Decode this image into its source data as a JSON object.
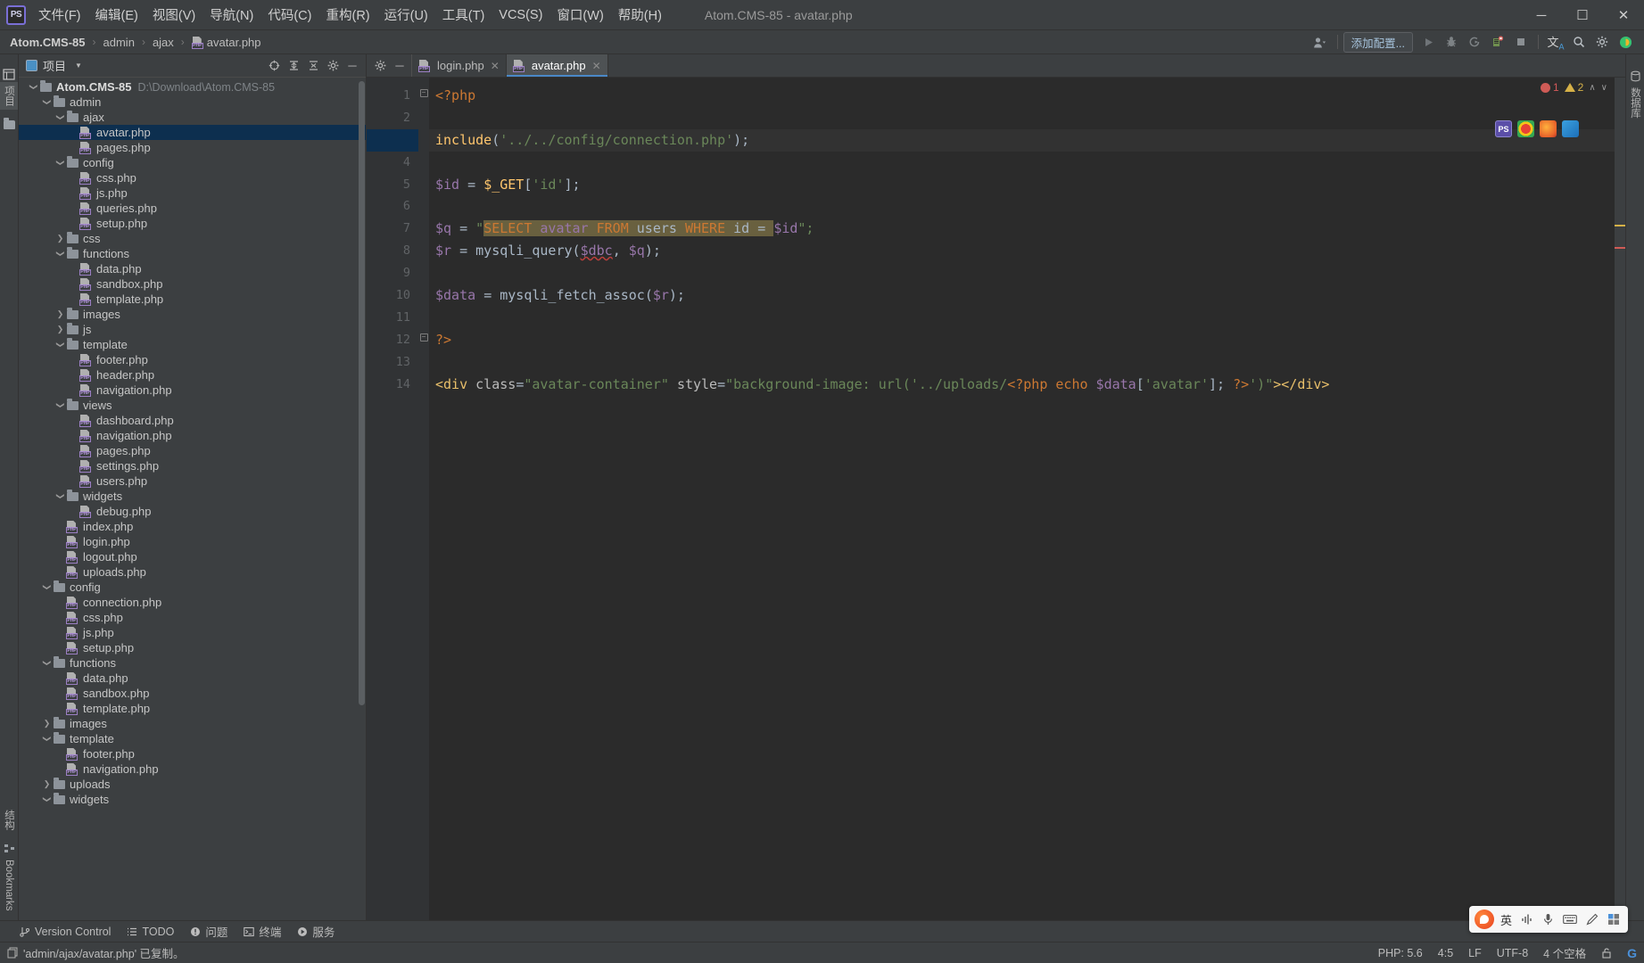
{
  "window": {
    "title": "Atom.CMS-85 - avatar.php",
    "logo_text": "PS",
    "minimize": "─",
    "maximize": "☐",
    "close": "✕"
  },
  "menubar": {
    "items": [
      {
        "label": "文件(F)",
        "name": "menu-file"
      },
      {
        "label": "编辑(E)",
        "name": "menu-edit"
      },
      {
        "label": "视图(V)",
        "name": "menu-view"
      },
      {
        "label": "导航(N)",
        "name": "menu-navigate"
      },
      {
        "label": "代码(C)",
        "name": "menu-code"
      },
      {
        "label": "重构(R)",
        "name": "menu-refactor"
      },
      {
        "label": "运行(U)",
        "name": "menu-run"
      },
      {
        "label": "工具(T)",
        "name": "menu-tools"
      },
      {
        "label": "VCS(S)",
        "name": "menu-vcs"
      },
      {
        "label": "窗口(W)",
        "name": "menu-window"
      },
      {
        "label": "帮助(H)",
        "name": "menu-help"
      }
    ]
  },
  "breadcrumb": {
    "items": [
      "Atom.CMS-85",
      "admin",
      "ajax",
      "avatar.php"
    ],
    "separator": "›"
  },
  "navtoolbar": {
    "add_config_label": "添加配置...",
    "icons": [
      {
        "name": "user-account-icon",
        "glyph": "👤"
      },
      {
        "name": "run-icon",
        "glyph": "▶"
      },
      {
        "name": "debug-icon",
        "glyph": "🐞"
      },
      {
        "name": "run-with-coverage-icon",
        "glyph": "⟳"
      },
      {
        "name": "profile-icon",
        "glyph": "⚙"
      },
      {
        "name": "stop-icon",
        "glyph": "■"
      },
      {
        "name": "translate-icon",
        "glyph": "文"
      },
      {
        "name": "search-everywhere-icon",
        "glyph": "⚲"
      },
      {
        "name": "settings-gear-icon",
        "glyph": "⚙"
      },
      {
        "name": "browser-icon",
        "glyph": "◖"
      }
    ]
  },
  "left_strip": {
    "project_tab": "项目",
    "structure_tab": "结构",
    "bookmarks_tab": "Bookmarks"
  },
  "right_strip": {
    "database_tab": "数据库"
  },
  "project_panel": {
    "title": "项目",
    "header_icons": [
      {
        "name": "scroll-from-source-icon",
        "glyph": "⊕"
      },
      {
        "name": "expand-all-icon",
        "glyph": "⇥"
      },
      {
        "name": "collapse-all-icon",
        "glyph": "↥"
      },
      {
        "name": "settings-gear-icon",
        "glyph": "⚙"
      },
      {
        "name": "hide-icon",
        "glyph": "─"
      }
    ],
    "tree": [
      {
        "label": "Atom.CMS-85",
        "path": "D:\\Download\\Atom.CMS-85",
        "depth": 0,
        "type": "folder",
        "state": "expanded",
        "bold": true
      },
      {
        "label": "admin",
        "depth": 1,
        "type": "folder",
        "state": "expanded"
      },
      {
        "label": "ajax",
        "depth": 2,
        "type": "folder",
        "state": "expanded"
      },
      {
        "label": "avatar.php",
        "depth": 3,
        "type": "php",
        "selected": true
      },
      {
        "label": "pages.php",
        "depth": 3,
        "type": "php"
      },
      {
        "label": "config",
        "depth": 2,
        "type": "folder",
        "state": "expanded"
      },
      {
        "label": "css.php",
        "depth": 3,
        "type": "php"
      },
      {
        "label": "js.php",
        "depth": 3,
        "type": "php"
      },
      {
        "label": "queries.php",
        "depth": 3,
        "type": "php"
      },
      {
        "label": "setup.php",
        "depth": 3,
        "type": "php"
      },
      {
        "label": "css",
        "depth": 2,
        "type": "folder",
        "state": "collapsed"
      },
      {
        "label": "functions",
        "depth": 2,
        "type": "folder",
        "state": "expanded"
      },
      {
        "label": "data.php",
        "depth": 3,
        "type": "php"
      },
      {
        "label": "sandbox.php",
        "depth": 3,
        "type": "php"
      },
      {
        "label": "template.php",
        "depth": 3,
        "type": "php"
      },
      {
        "label": "images",
        "depth": 2,
        "type": "folder",
        "state": "collapsed"
      },
      {
        "label": "js",
        "depth": 2,
        "type": "folder",
        "state": "collapsed"
      },
      {
        "label": "template",
        "depth": 2,
        "type": "folder",
        "state": "expanded"
      },
      {
        "label": "footer.php",
        "depth": 3,
        "type": "php"
      },
      {
        "label": "header.php",
        "depth": 3,
        "type": "php"
      },
      {
        "label": "navigation.php",
        "depth": 3,
        "type": "php"
      },
      {
        "label": "views",
        "depth": 2,
        "type": "folder",
        "state": "expanded"
      },
      {
        "label": "dashboard.php",
        "depth": 3,
        "type": "php"
      },
      {
        "label": "navigation.php",
        "depth": 3,
        "type": "php"
      },
      {
        "label": "pages.php",
        "depth": 3,
        "type": "php"
      },
      {
        "label": "settings.php",
        "depth": 3,
        "type": "php"
      },
      {
        "label": "users.php",
        "depth": 3,
        "type": "php"
      },
      {
        "label": "widgets",
        "depth": 2,
        "type": "folder",
        "state": "expanded"
      },
      {
        "label": "debug.php",
        "depth": 3,
        "type": "php"
      },
      {
        "label": "index.php",
        "depth": 2,
        "type": "php"
      },
      {
        "label": "login.php",
        "depth": 2,
        "type": "php"
      },
      {
        "label": "logout.php",
        "depth": 2,
        "type": "php"
      },
      {
        "label": "uploads.php",
        "depth": 2,
        "type": "php"
      },
      {
        "label": "config",
        "depth": 1,
        "type": "folder",
        "state": "expanded"
      },
      {
        "label": "connection.php",
        "depth": 2,
        "type": "php"
      },
      {
        "label": "css.php",
        "depth": 2,
        "type": "php"
      },
      {
        "label": "js.php",
        "depth": 2,
        "type": "php"
      },
      {
        "label": "setup.php",
        "depth": 2,
        "type": "php"
      },
      {
        "label": "functions",
        "depth": 1,
        "type": "folder",
        "state": "expanded"
      },
      {
        "label": "data.php",
        "depth": 2,
        "type": "php"
      },
      {
        "label": "sandbox.php",
        "depth": 2,
        "type": "php"
      },
      {
        "label": "template.php",
        "depth": 2,
        "type": "php"
      },
      {
        "label": "images",
        "depth": 1,
        "type": "folder",
        "state": "collapsed"
      },
      {
        "label": "template",
        "depth": 1,
        "type": "folder",
        "state": "expanded"
      },
      {
        "label": "footer.php",
        "depth": 2,
        "type": "php"
      },
      {
        "label": "navigation.php",
        "depth": 2,
        "type": "php"
      },
      {
        "label": "uploads",
        "depth": 1,
        "type": "folder",
        "state": "collapsed"
      },
      {
        "label": "widgets",
        "depth": 1,
        "type": "folder",
        "state": "expanded"
      }
    ]
  },
  "editor": {
    "tabs": [
      {
        "label": "login.php",
        "active": false,
        "name": "editor-tab-login"
      },
      {
        "label": "avatar.php",
        "active": true,
        "name": "editor-tab-avatar"
      }
    ],
    "tab_close_glyph": "✕",
    "inspection": {
      "errors": "1",
      "warnings": "2",
      "up_arrow": "∧",
      "down_arrow": "∨"
    },
    "float_buttons": [
      {
        "name": "phpstorm-badge",
        "label": "PS",
        "color": "#6f5fc0"
      },
      {
        "name": "chrome-badge",
        "label": "",
        "color": "#f0b429"
      },
      {
        "name": "firefox-badge",
        "label": "",
        "color": "#e8622a"
      },
      {
        "name": "edge-badge",
        "label": "",
        "color": "#3aa0e0"
      }
    ],
    "line_numbers": [
      "1",
      "2",
      "3",
      "4",
      "5",
      "6",
      "7",
      "8",
      "9",
      "10",
      "11",
      "12",
      "13",
      "14"
    ],
    "current_line": 3,
    "code_lines": [
      {
        "n": 1,
        "tokens": [
          {
            "t": "<?php",
            "c": "kw"
          }
        ]
      },
      {
        "n": 2,
        "tokens": []
      },
      {
        "n": 3,
        "tokens": [
          {
            "t": "include",
            "c": "fn"
          },
          {
            "t": "(",
            "c": "pl"
          },
          {
            "t": "'../../config/connection.php'",
            "c": "str"
          },
          {
            "t": ");",
            "c": "pl"
          }
        ]
      },
      {
        "n": 4,
        "tokens": []
      },
      {
        "n": 5,
        "tokens": [
          {
            "t": "$id ",
            "c": "var"
          },
          {
            "t": "= ",
            "c": "pl"
          },
          {
            "t": "$_GET",
            "c": "fn"
          },
          {
            "t": "[",
            "c": "pl"
          },
          {
            "t": "'id'",
            "c": "str"
          },
          {
            "t": "];",
            "c": "pl"
          }
        ]
      },
      {
        "n": 6,
        "tokens": []
      },
      {
        "n": 7,
        "tokens": [
          {
            "t": "$q ",
            "c": "var"
          },
          {
            "t": "= ",
            "c": "pl"
          },
          {
            "t": "\"",
            "c": "str"
          },
          {
            "t": "SELECT ",
            "c": "sql-kw sqlbg"
          },
          {
            "t": "avatar ",
            "c": "sql-id sqlbg"
          },
          {
            "t": "FROM ",
            "c": "sql-kw sqlbg"
          },
          {
            "t": "users ",
            "c": "sql-pl sqlbg"
          },
          {
            "t": "WHERE ",
            "c": "sql-kw sqlbg"
          },
          {
            "t": "id ",
            "c": "sql-pl sqlbg"
          },
          {
            "t": "= ",
            "c": "sql-pl sqlbg"
          },
          {
            "t": "$id",
            "c": "var"
          },
          {
            "t": "\";",
            "c": "str"
          }
        ]
      },
      {
        "n": 8,
        "tokens": [
          {
            "t": "$r ",
            "c": "var"
          },
          {
            "t": "= ",
            "c": "pl"
          },
          {
            "t": "mysqli_query",
            "c": "pl"
          },
          {
            "t": "(",
            "c": "pl"
          },
          {
            "t": "$dbc",
            "c": "var wavy"
          },
          {
            "t": ", ",
            "c": "pl"
          },
          {
            "t": "$q",
            "c": "var"
          },
          {
            "t": ");",
            "c": "pl"
          }
        ]
      },
      {
        "n": 9,
        "tokens": []
      },
      {
        "n": 10,
        "tokens": [
          {
            "t": "$data ",
            "c": "var"
          },
          {
            "t": "= ",
            "c": "pl"
          },
          {
            "t": "mysqli_fetch_assoc",
            "c": "pl"
          },
          {
            "t": "(",
            "c": "pl"
          },
          {
            "t": "$r",
            "c": "var"
          },
          {
            "t": ");",
            "c": "pl"
          }
        ]
      },
      {
        "n": 11,
        "tokens": []
      },
      {
        "n": 12,
        "tokens": [
          {
            "t": "?>",
            "c": "kw"
          }
        ]
      },
      {
        "n": 13,
        "tokens": []
      },
      {
        "n": 14,
        "tokens": [
          {
            "t": "<div ",
            "c": "tag"
          },
          {
            "t": "class",
            "c": "attr"
          },
          {
            "t": "=",
            "c": "pl"
          },
          {
            "t": "\"avatar-container\"",
            "c": "str"
          },
          {
            "t": " ",
            "c": "pl"
          },
          {
            "t": "style",
            "c": "attr"
          },
          {
            "t": "=",
            "c": "pl"
          },
          {
            "t": "\"background-image: url('../uploads/",
            "c": "str"
          },
          {
            "t": "<?php ",
            "c": "kw"
          },
          {
            "t": "echo ",
            "c": "kw"
          },
          {
            "t": "$data",
            "c": "var"
          },
          {
            "t": "[",
            "c": "pl"
          },
          {
            "t": "'avatar'",
            "c": "str"
          },
          {
            "t": "]; ",
            "c": "pl"
          },
          {
            "t": "?>",
            "c": "kw"
          },
          {
            "t": "')\"",
            "c": "str"
          },
          {
            "t": "></div>",
            "c": "tag"
          }
        ]
      }
    ]
  },
  "tool_window_bar": {
    "items": [
      {
        "label": "Version Control",
        "name": "tool-version-control",
        "glyph": "⎇"
      },
      {
        "label": "TODO",
        "name": "tool-todo",
        "glyph": "☰"
      },
      {
        "label": "问题",
        "name": "tool-problems",
        "glyph": "❗"
      },
      {
        "label": "终端",
        "name": "tool-terminal",
        "glyph": "⌨"
      },
      {
        "label": "服务",
        "name": "tool-services",
        "glyph": "▶"
      }
    ]
  },
  "statusbar": {
    "message": "'admin/ajax/avatar.php' 已复制。",
    "message_icon": "copy-icon",
    "php_version": "PHP: 5.6",
    "caret_position": "4:5",
    "line_separator": "LF",
    "encoding": "UTF-8",
    "indent": "4 个空格",
    "lock_icon": "🔓",
    "git_icon": "G"
  },
  "ime": {
    "mode": "英",
    "items": [
      "英",
      "♪",
      "🎤",
      "⌨",
      "✎",
      "⬚"
    ]
  }
}
